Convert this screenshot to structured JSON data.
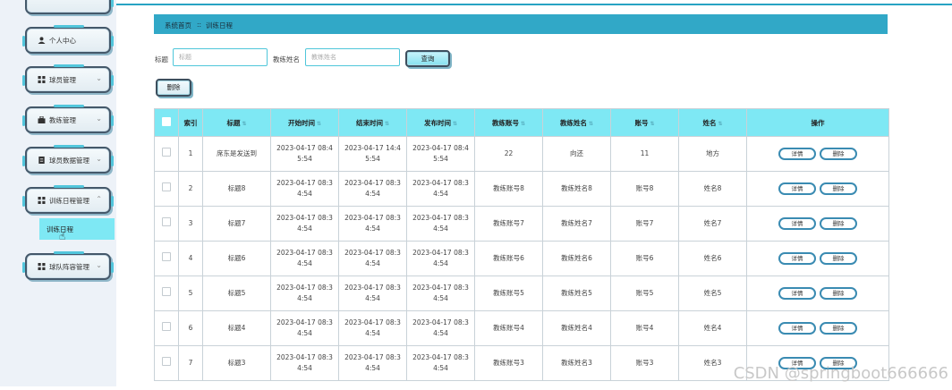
{
  "sidebar": {
    "items": [
      {
        "label": "个人中心",
        "icon": "user-icon",
        "chevron": "⌄"
      },
      {
        "label": "球员管理",
        "icon": "grid-icon",
        "chevron": "⌄"
      },
      {
        "label": "教练管理",
        "icon": "briefcase-icon",
        "chevron": "⌄"
      },
      {
        "label": "球员数据管理",
        "icon": "document-icon",
        "chevron": "⌄"
      },
      {
        "label": "训练日程管理",
        "icon": "grid-icon",
        "chevron": "⌃"
      },
      {
        "label": "球队阵容管理",
        "icon": "grid-icon",
        "chevron": "⌄"
      }
    ],
    "active_sub": "训练日程"
  },
  "breadcrumb": {
    "home": "系统首页",
    "sep": "::",
    "current": "训练日程"
  },
  "search": {
    "title_label": "标题",
    "title_placeholder": "标题",
    "coach_label": "教练姓名",
    "coach_placeholder": "教练姓名",
    "query_label": "查询"
  },
  "toolbar": {
    "delete_label": "删除"
  },
  "table": {
    "headers": [
      "索引",
      "标题",
      "开始时间",
      "结束时间",
      "发布时间",
      "教练账号",
      "教练姓名",
      "账号",
      "姓名",
      "操作"
    ],
    "detail_label": "详情",
    "delete_label": "删除",
    "rows": [
      [
        "1",
        "席东是发送到",
        "2023-04-17 08:4\n5:54",
        "2023-04-17 14:4\n5:54",
        "2023-04-17 08:4\n5:54",
        "22",
        "向还",
        "11",
        "地方"
      ],
      [
        "2",
        "标题8",
        "2023-04-17 08:3\n4:54",
        "2023-04-17 08:3\n4:54",
        "2023-04-17 08:3\n4:54",
        "教练账号8",
        "教练姓名8",
        "账号8",
        "姓名8"
      ],
      [
        "3",
        "标题7",
        "2023-04-17 08:3\n4:54",
        "2023-04-17 08:3\n4:54",
        "2023-04-17 08:3\n4:54",
        "教练账号7",
        "教练姓名7",
        "账号7",
        "姓名7"
      ],
      [
        "4",
        "标题6",
        "2023-04-17 08:3\n4:54",
        "2023-04-17 08:3\n4:54",
        "2023-04-17 08:3\n4:54",
        "教练账号6",
        "教练姓名6",
        "账号6",
        "姓名6"
      ],
      [
        "5",
        "标题5",
        "2023-04-17 08:3\n4:54",
        "2023-04-17 08:3\n4:54",
        "2023-04-17 08:3\n4:54",
        "教练账号5",
        "教练姓名5",
        "账号5",
        "姓名5"
      ],
      [
        "6",
        "标题4",
        "2023-04-17 08:3\n4:54",
        "2023-04-17 08:3\n4:54",
        "2023-04-17 08:3\n4:54",
        "教练账号4",
        "教练姓名4",
        "账号4",
        "姓名4"
      ],
      [
        "7",
        "标题3",
        "2023-04-17 08:3\n4:54",
        "2023-04-17 08:3\n4:54",
        "2023-04-17 08:3\n4:54",
        "教练账号3",
        "教练姓名3",
        "账号3",
        "姓名3"
      ]
    ]
  },
  "watermark": "CSDN @springboot666666",
  "colors": {
    "accent": "#31a8c7",
    "header_bg": "#7ee8f4",
    "button_border": "#3a8bb2"
  }
}
